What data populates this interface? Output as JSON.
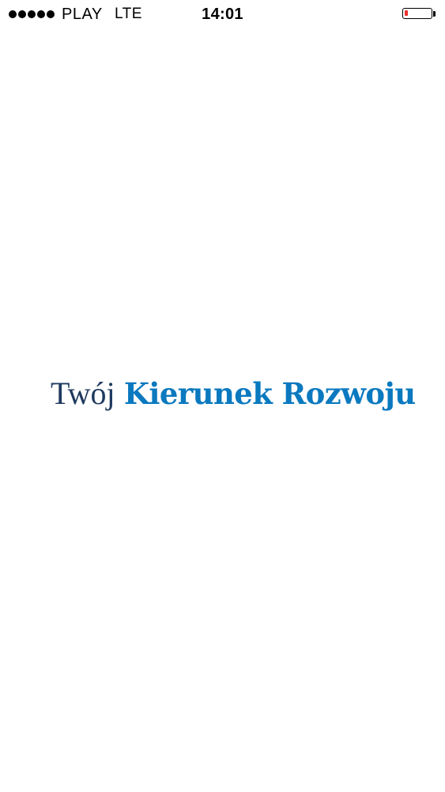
{
  "status_bar": {
    "signal_bars": 5,
    "carrier": "PLAY",
    "network": "LTE",
    "time": "14:01",
    "battery_level": 0.12,
    "battery_color": "#e8322f"
  },
  "splash": {
    "logo_light": "Twój",
    "logo_bold": "Kierunek Rozwoju",
    "logo_light_color": "#1f3a5f",
    "logo_bold_color": "#0a79bf"
  }
}
